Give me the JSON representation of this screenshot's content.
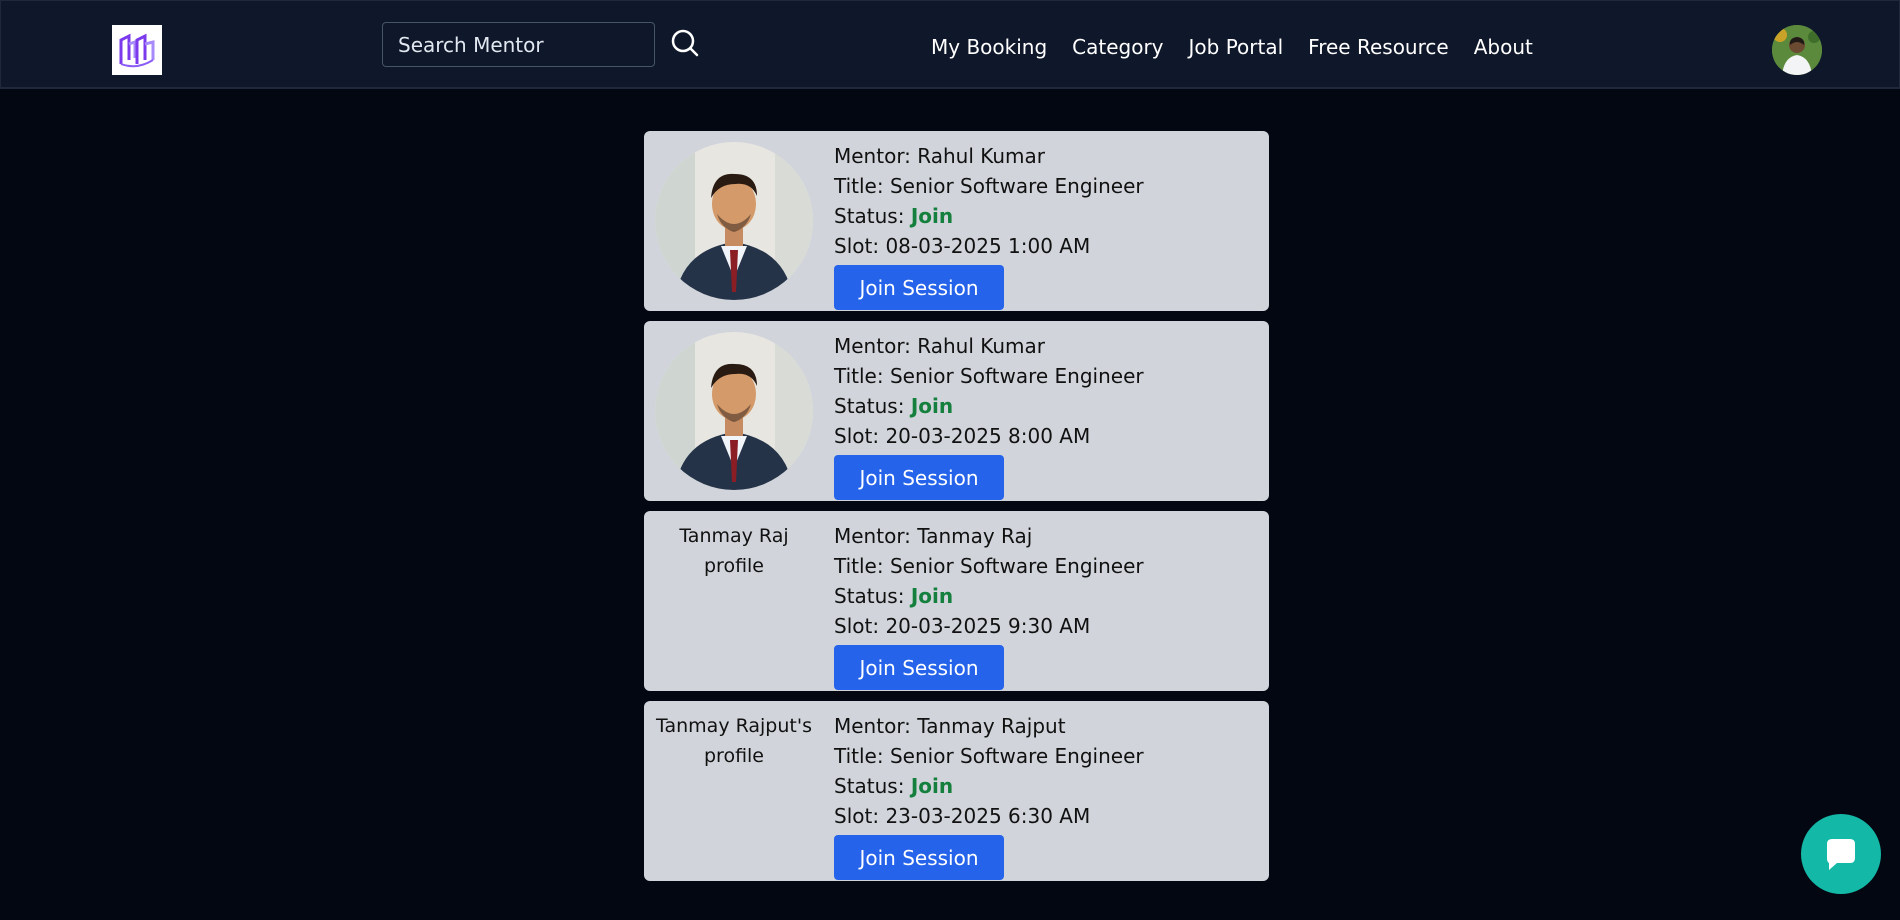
{
  "header": {
    "search": {
      "placeholder": "Search Mentor",
      "value": ""
    },
    "nav": [
      {
        "label": "My Booking"
      },
      {
        "label": "Category"
      },
      {
        "label": "Job Portal"
      },
      {
        "label": "Free Resource"
      },
      {
        "label": "About"
      }
    ],
    "icons": {
      "search": "search-icon",
      "logo": "logo-icon",
      "avatar": "user-avatar"
    }
  },
  "labels": {
    "mentor": "Mentor: ",
    "title": "Title: ",
    "status": "Status: ",
    "slot": "Slot: "
  },
  "bookings": [
    {
      "mentor": "Rahul Kumar",
      "title": "Senior Software Engineer",
      "status": "Join",
      "slot": "08-03-2025 1:00 AM",
      "button": "Join Session",
      "photo_alt": ""
    },
    {
      "mentor": "Rahul Kumar",
      "title": "Senior Software Engineer",
      "status": "Join",
      "slot": "20-03-2025 8:00 AM",
      "button": "Join Session",
      "photo_alt": ""
    },
    {
      "mentor": "Tanmay Raj",
      "title": "Senior Software Engineer",
      "status": "Join",
      "slot": "20-03-2025 9:30 AM",
      "button": "Join Session",
      "photo_alt": "Tanmay Raj profile"
    },
    {
      "mentor": "Tanmay Rajput",
      "title": "Senior Software Engineer",
      "status": "Join",
      "slot": "23-03-2025 6:30 AM",
      "button": "Join Session",
      "photo_alt": "Tanmay Rajput's profile"
    }
  ],
  "chat": {
    "icon": "chat-icon"
  },
  "colors": {
    "background": "#030712",
    "navbar": "#0f172a",
    "card": "#d1d5db",
    "button": "#2563eb",
    "status": "#15803d",
    "chat": "#14b8a6"
  }
}
